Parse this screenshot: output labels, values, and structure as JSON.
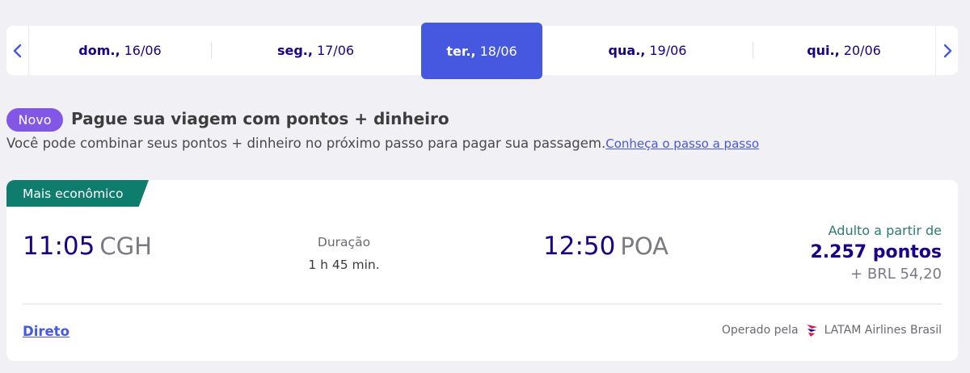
{
  "date_nav": {
    "prev_icon": "chevron-left-icon",
    "next_icon": "chevron-right-icon",
    "days": [
      {
        "weekday": "dom.,",
        "date": "16/06",
        "selected": false
      },
      {
        "weekday": "seg.,",
        "date": "17/06",
        "selected": false
      },
      {
        "weekday": "ter.,",
        "date": "18/06",
        "selected": true
      },
      {
        "weekday": "qua.,",
        "date": "19/06",
        "selected": false
      },
      {
        "weekday": "qui.,",
        "date": "20/06",
        "selected": false
      }
    ]
  },
  "promo": {
    "badge": "Novo",
    "title": "Pague sua viagem com pontos + dinheiro",
    "text": "Você pode combinar seus pontos + dinheiro no próximo passo para pagar sua passagem.",
    "link": "Conheça o passo a passo"
  },
  "flight": {
    "tag": "Mais econômico",
    "departure": {
      "time": "11:05",
      "code": "CGH"
    },
    "duration": {
      "label": "Duração",
      "value": "1 h 45 min."
    },
    "arrival": {
      "time": "12:50",
      "code": "POA"
    },
    "price": {
      "label": "Adulto a partir de",
      "points": "2.257 pontos",
      "money": "+ BRL 54,20"
    },
    "stops": "Direto",
    "operated_label": "Operado pela",
    "airline": "LATAM Airlines Brasil"
  },
  "colors": {
    "accent": "#4658df",
    "brand_navy": "#1b0088",
    "tag_green": "#0e7d6e",
    "badge_purple": "#8257e6"
  }
}
